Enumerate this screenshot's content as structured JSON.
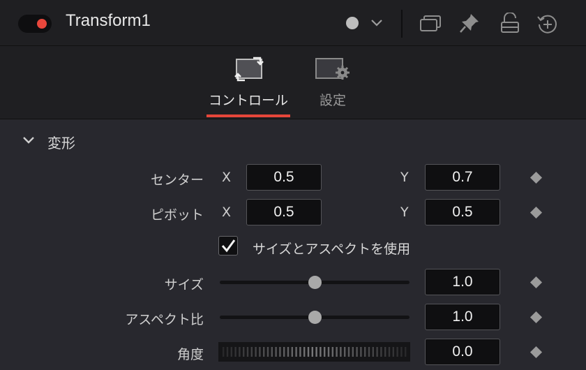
{
  "node": {
    "title": "Transform1",
    "enabled": true,
    "toggle_color": "#e8473c"
  },
  "header_icons": [
    "color-dot-icon",
    "chevron-down-icon",
    "versions-icon",
    "pin-icon",
    "lock-icon",
    "reset-icon"
  ],
  "tabs": [
    {
      "label": "コントロール",
      "icon": "transform-icon",
      "active": true
    },
    {
      "label": "設定",
      "icon": "settings-gear-icon",
      "active": false
    }
  ],
  "accent_color": "#e5463a",
  "section": {
    "title": "変形",
    "expanded": true
  },
  "center": {
    "label": "センター",
    "x_axis": "X",
    "x_value": "0.5",
    "y_axis": "Y",
    "y_value": "0.7"
  },
  "pivot": {
    "label": "ピボット",
    "x_axis": "X",
    "x_value": "0.5",
    "y_axis": "Y",
    "y_value": "0.5"
  },
  "use_size_aspect": {
    "label": "サイズとアスペクトを使用",
    "checked": true
  },
  "size": {
    "label": "サイズ",
    "value": "1.0",
    "slider_fraction": 0.5
  },
  "aspect": {
    "label": "アスペクト比",
    "value": "1.0",
    "slider_fraction": 0.5
  },
  "angle": {
    "label": "角度",
    "value": "0.0"
  }
}
